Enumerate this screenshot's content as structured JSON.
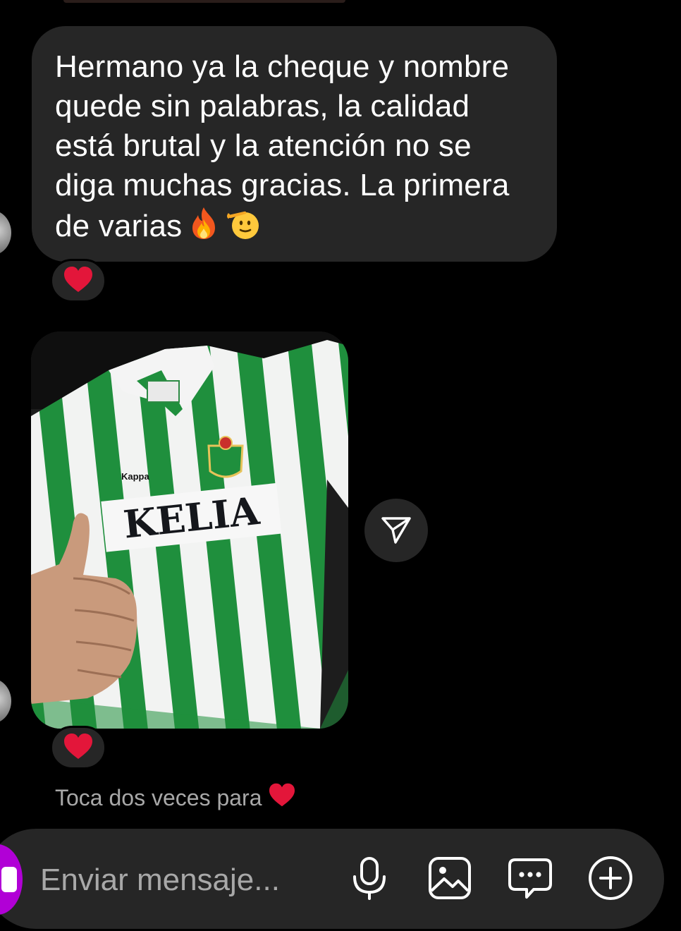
{
  "conversation": {
    "message_1": {
      "text": "Hermano ya la cheque y nombre quede sin palabras, la calidad está brutal y la atención no se diga muchas gracias. La primera de varias",
      "emojis": [
        "🔥",
        "🫡"
      ],
      "reaction": "❤️"
    },
    "message_2": {
      "type": "photo",
      "photo_text": {
        "brand": "Kappa",
        "sponsor": "KELIA"
      },
      "reaction": "❤️"
    },
    "hint": {
      "text": "Toca dos veces para",
      "emoji": "❤️"
    }
  },
  "composer": {
    "placeholder": "Enviar mensaje...",
    "icons": [
      "camera-icon",
      "microphone-icon",
      "gallery-icon",
      "sticker-icon",
      "plus-icon"
    ]
  },
  "colors": {
    "background": "#000000",
    "bubble": "#262626",
    "accent_camera": "#B100D6",
    "heart": "#E3163A",
    "hint_text": "#A8A8A8"
  }
}
